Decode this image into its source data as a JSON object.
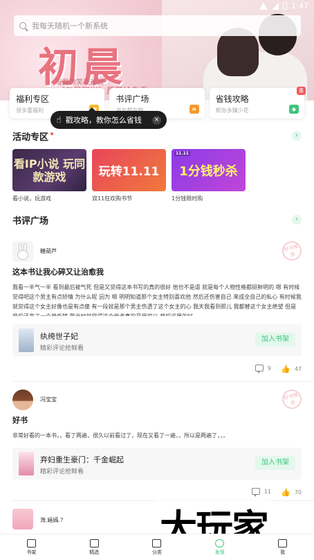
{
  "status": {
    "time": "1:47"
  },
  "search": {
    "placeholder": "我每天随机一个新系统"
  },
  "hero": {
    "title": "初晨",
    "sub1": "每我微笑流过我",
    "sub2": "《与晨同光》原著抢先看"
  },
  "quick": [
    {
      "title": "福利专区",
      "subtitle": "领多重福利",
      "icon": "gift-icon"
    },
    {
      "title": "书评广场",
      "subtitle": "书友都在聊",
      "icon": "chat-icon"
    },
    {
      "title": "省钱攻略",
      "subtitle": "帮你多赚少花",
      "icon": "wallet-icon",
      "badge": "惠"
    }
  ],
  "tooltip": {
    "text": "戳攻略，教你怎么省钱"
  },
  "activity": {
    "title": "活动专区",
    "items": [
      {
        "img_text": "看IP小说 玩同款游戏",
        "caption": "看小说，玩游戏"
      },
      {
        "img_text": "玩转11.11",
        "caption": "双11狂欢购书节"
      },
      {
        "img_text": "1分钱秒杀",
        "caption": "1分钱限时购",
        "tag": "11.11"
      }
    ]
  },
  "reviews_section": {
    "title": "书评广场"
  },
  "reviews": [
    {
      "user": "糖葫芦",
      "title": "这本书让我心碎又让治愈我",
      "body": "我看一半气一半 看到最后被气死 但是又觉得这本书写的真的很好 他也不是虐 就是每个人物性格都挺鲜明的 嗯 有时候觉得吧这个男主有点矫情 为什么呢 因为 嗯 明明知道那个女主特别喜欢他 然后还伤害自己 来成全自己的私心 有时候我就觉得这个女主好像也是有点傻 有一段就是那个男主伤透了这个女主的心 我天我看到那儿 我都替这个女主绝望 但是最后还来了一个神反转 我当时就觉得这个作者真的是很可以 然后这里的好...",
      "book_name": "纨绔世子妃",
      "book_sub": "精彩评论抢鲜看",
      "add_label": "加入书架",
      "comments": "9",
      "likes": "47"
    },
    {
      "user": "冯宝宝",
      "title": "好书",
      "body": "非常好看的一本书，，看了两遍，很久以前看过了，现在又看了一遍，，所以是两遍了，，，",
      "book_name": "弃妇重生豪门：千金崛起",
      "book_sub": "精彩评论抢鲜看",
      "add_label": "加入书架",
      "comments": "11",
      "likes": "70"
    },
    {
      "user": "溦.婳嫣.?"
    }
  ],
  "stamp_text": "好书推荐",
  "nav": [
    {
      "label": "书架",
      "active": false
    },
    {
      "label": "精选",
      "active": false
    },
    {
      "label": "分类",
      "active": false
    },
    {
      "label": "发现",
      "active": true
    },
    {
      "label": "我",
      "active": false
    }
  ],
  "watermark": "大玩家",
  "colors": {
    "accent": "#3cc57c",
    "hero_pink": "#e9727f",
    "badge_red": "#f05a5a"
  }
}
